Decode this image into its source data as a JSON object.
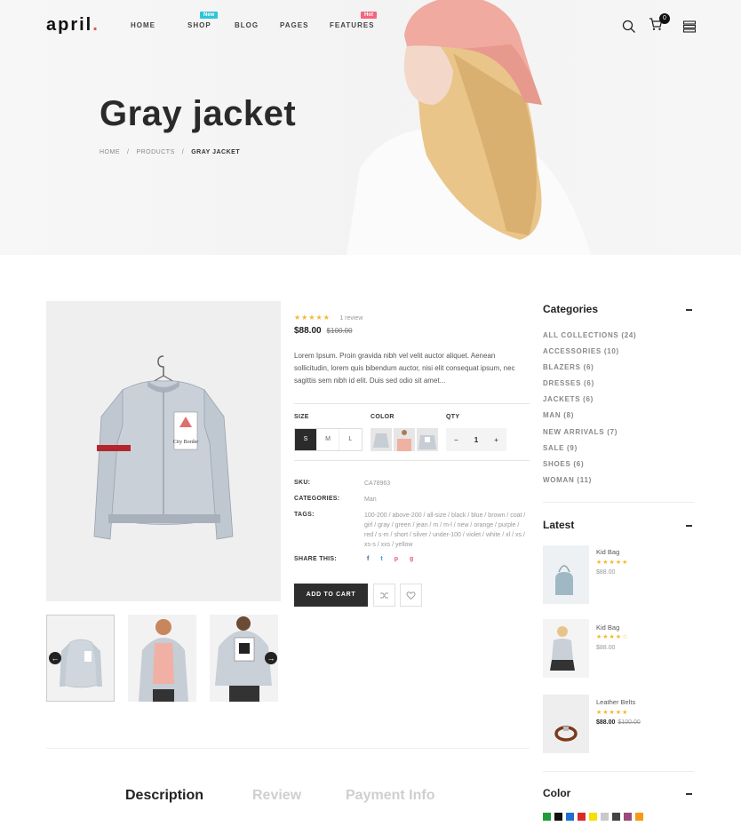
{
  "header": {
    "logo_text": "april",
    "logo_dot": ".",
    "nav": [
      {
        "label": "HOME",
        "badge": ""
      },
      {
        "label": "SHOP",
        "badge": "New",
        "badge_color": "#2ec5d8"
      },
      {
        "label": "BLOG",
        "badge": ""
      },
      {
        "label": "PAGES",
        "badge": ""
      },
      {
        "label": "FEATURES",
        "badge": "Hot",
        "badge_color": "#f3677d"
      }
    ],
    "cart_count": "0"
  },
  "hero": {
    "title": "Gray jacket",
    "breadcrumb": [
      "HOME",
      "PRODUCTS",
      "GRAY JACKET"
    ],
    "separator": "/"
  },
  "product": {
    "stars": "★★★★★",
    "review_text": "1 review",
    "price": "$88.00",
    "old_price": "$100.00",
    "description": "Lorem Ipsum. Proin gravida nibh vel velit auctor aliquet. Aenean sollicitudin, lorem quis bibendum auctor, nisi elit consequat ipsum, nec sagittis sem nibh id elit. Duis sed odio sit amet...",
    "size_label": "SIZE",
    "sizes": [
      "S",
      "M",
      "L"
    ],
    "selected_size": "S",
    "color_label": "COLOR",
    "qty_label": "QTY",
    "qty_minus": "−",
    "qty_value": "1",
    "qty_plus": "+",
    "sku_label": "SKU:",
    "sku_value": "CA78963",
    "categories_label": "CATEGORIES:",
    "categories_value": "Man",
    "tags_label": "TAGS:",
    "tags_value": "100-200 / above-200 / all-size / black / blue / brown / coat / girl / gray / green / jean / m / m-l / new / orange / purple / red / s-m / short / silver / under-100 / violet / white / xl / xs / xs-s / xxs / yellow",
    "share_label": "SHARE THIS:",
    "share_icons": [
      {
        "glyph": "f",
        "color": "#3b5998"
      },
      {
        "glyph": "t",
        "color": "#1da1f2"
      },
      {
        "glyph": "p",
        "color": "#e85a6e"
      },
      {
        "glyph": "g",
        "color": "#e85a6e"
      }
    ],
    "add_to_cart": "ADD TO CART",
    "prev_arrow": "←",
    "next_arrow": "→",
    "thumb_arrows": "",
    "jacket_patch_text": "City Border"
  },
  "sidebar": {
    "categories_title": "Categories",
    "categories": [
      "ALL COLLECTIONS (24)",
      "ACCESSORIES (10)",
      "BLAZERS (6)",
      "DRESSES (6)",
      "JACKETS (6)",
      "MAN (8)",
      "NEW ARRIVALS (7)",
      "SALE (9)",
      "SHOES (6)",
      "WOMAN (11)"
    ],
    "latest_title": "Latest",
    "latest": [
      {
        "name": "Kid Bag",
        "stars": "★★★★★",
        "price": "$88.00",
        "old_price": ""
      },
      {
        "name": "Kid Bag",
        "stars": "★★★★☆",
        "price": "$88.00",
        "old_price": ""
      },
      {
        "name": "Leather Belts",
        "stars": "★★★★★",
        "price": "$88.00",
        "old_price": "$100.00"
      }
    ],
    "color_title": "Color",
    "colors": [
      "#1e9c3c",
      "#111111",
      "#1f6fcf",
      "#d92a2a",
      "#f5e000",
      "#c9c9c9",
      "#444444",
      "#9c4a7a",
      "#f59b12"
    ]
  },
  "tabs": [
    "Description",
    "Review",
    "Payment Info"
  ]
}
